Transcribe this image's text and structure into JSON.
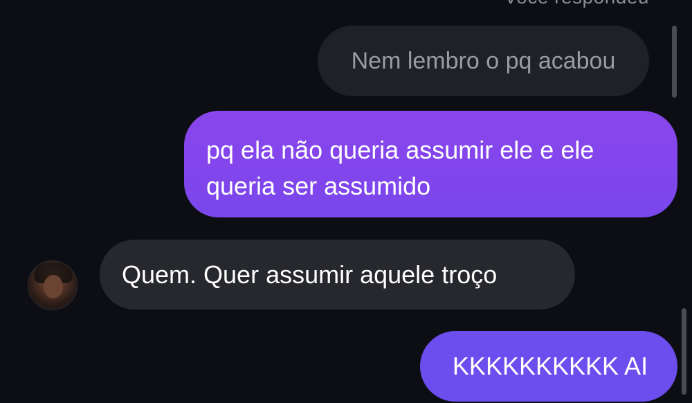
{
  "reply_header": "Você respondeu",
  "messages": {
    "quoted": "Nem lembro o pq acabou",
    "sent_1_line_1": "pq ela não queria assumir ele e ele",
    "sent_1_line_2": "queria ser assumido",
    "received": "Quem. Quer assumir aquele troço",
    "sent_2": "KKKKKKKKKK AI"
  },
  "colors": {
    "background": "#0c0e13",
    "sent_bubble": "#8a45ec",
    "received_bubble": "#26282d",
    "quoted_bubble": "#1f2126"
  }
}
